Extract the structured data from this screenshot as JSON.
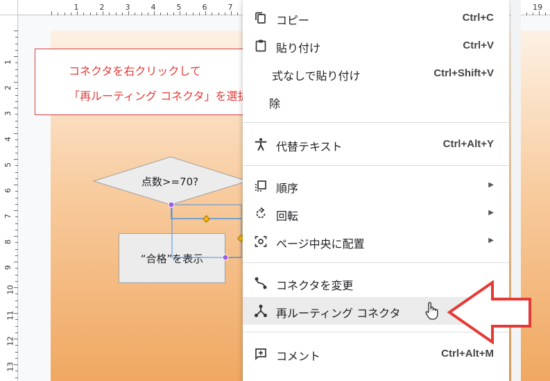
{
  "ruler": {
    "top_numbers": [
      "1",
      "2",
      "3",
      "4",
      "5",
      "6",
      "7",
      "19"
    ],
    "left_numbers": [
      "1",
      "2",
      "3",
      "4",
      "5",
      "6",
      "7",
      "8",
      "9",
      "10",
      "11",
      "12",
      "13"
    ]
  },
  "callout": {
    "line1": "コネクタを右クリックして",
    "line2": "「再ルーティング コネクタ」を選択"
  },
  "flowchart": {
    "decision_label": "点数>=70?",
    "process_label": "“合格”を表示"
  },
  "context_menu": {
    "items": [
      {
        "label": "コピー",
        "shortcut": "Ctrl+C",
        "icon": "copy-icon"
      },
      {
        "label": "貼り付け",
        "shortcut": "Ctrl+V",
        "icon": "paste-icon"
      },
      {
        "label": "式なしで貼り付け",
        "shortcut": "Ctrl+Shift+V",
        "icon": "paste-plain-icon"
      },
      {
        "label": "除",
        "shortcut": "",
        "icon": "delete-icon"
      },
      {
        "label": "代替テキスト",
        "shortcut": "Ctrl+Alt+Y",
        "icon": "accessibility-icon"
      },
      {
        "label": "順序",
        "submenu": true,
        "icon": "order-icon"
      },
      {
        "label": "回転",
        "submenu": true,
        "icon": "rotate-icon"
      },
      {
        "label": "ページ中央に配置",
        "submenu": true,
        "icon": "center-icon"
      },
      {
        "label": "コネクタを変更",
        "shortcut": "",
        "icon": "connector-icon"
      },
      {
        "label": "再ルーティング コネクタ",
        "shortcut": "",
        "icon": "reroute-icon",
        "highlighted": true
      },
      {
        "label": "コメント",
        "shortcut": "Ctrl+Alt+M",
        "icon": "comment-add-icon"
      }
    ]
  },
  "colors": {
    "callout_text": "#e53935",
    "arrow": "#e53935",
    "selection": "#4a90e2",
    "handle": "#9c5fe0"
  }
}
